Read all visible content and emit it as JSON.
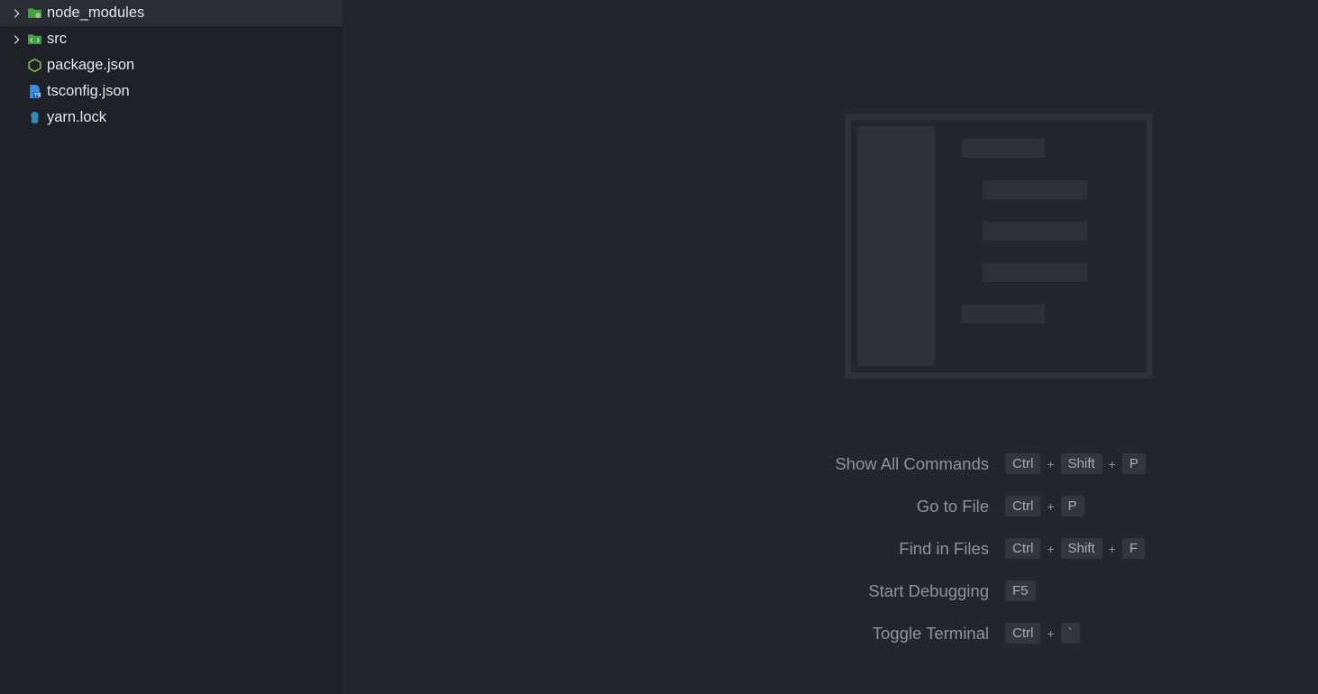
{
  "explorer": {
    "items": [
      {
        "label": "node_modules",
        "expandable": true,
        "icon": "folder-nodejs"
      },
      {
        "label": "src",
        "expandable": true,
        "icon": "folder-src"
      },
      {
        "label": "package.json",
        "expandable": false,
        "icon": "nodejs-icon"
      },
      {
        "label": "tsconfig.json",
        "expandable": false,
        "icon": "ts-json-icon"
      },
      {
        "label": "yarn.lock",
        "expandable": false,
        "icon": "yarn-icon"
      }
    ]
  },
  "shortcuts": [
    {
      "label": "Show All Commands",
      "keys": [
        "Ctrl",
        "Shift",
        "P"
      ]
    },
    {
      "label": "Go to File",
      "keys": [
        "Ctrl",
        "P"
      ]
    },
    {
      "label": "Find in Files",
      "keys": [
        "Ctrl",
        "Shift",
        "F"
      ]
    },
    {
      "label": "Start Debugging",
      "keys": [
        "F5"
      ]
    },
    {
      "label": "Toggle Terminal",
      "keys": [
        "Ctrl",
        "`"
      ]
    }
  ]
}
